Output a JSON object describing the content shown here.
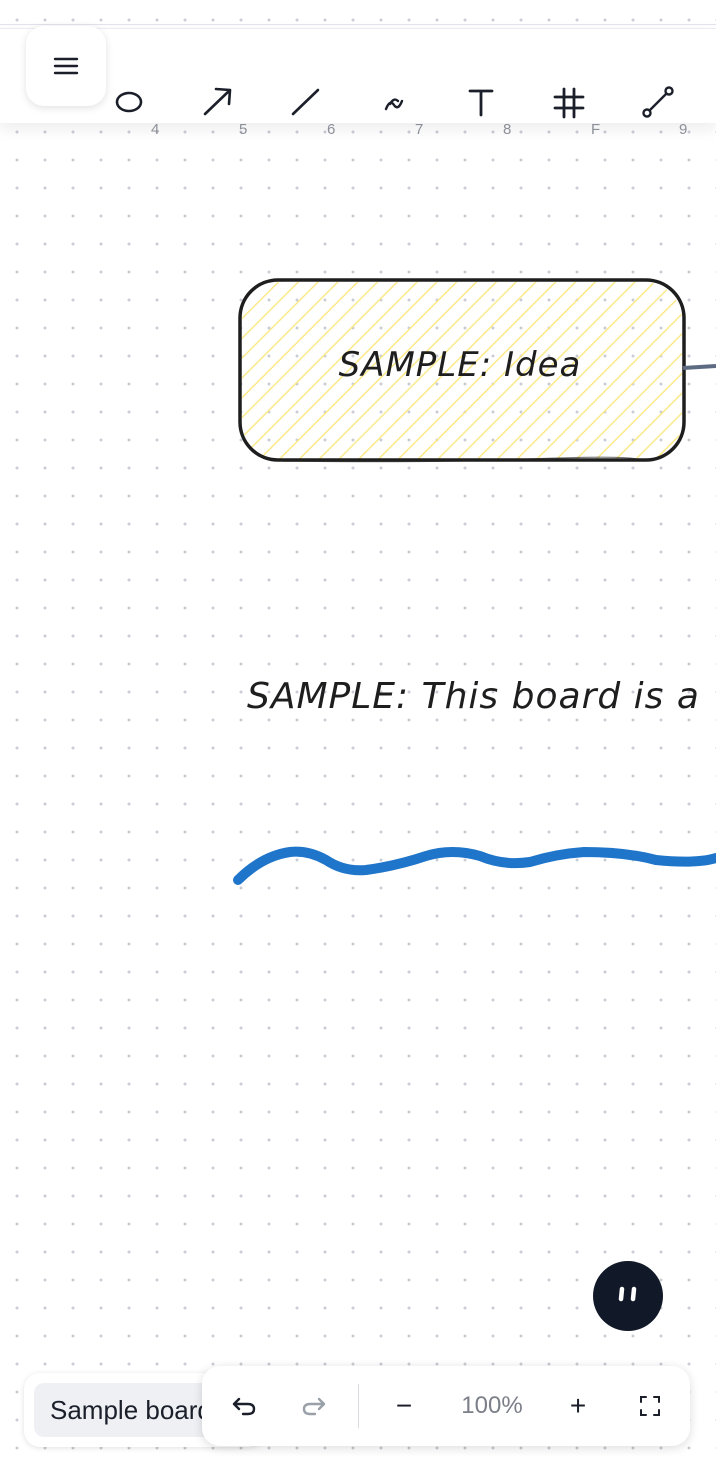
{
  "toolbar": {
    "menu_icon": "hamburger-menu-icon",
    "tools": [
      {
        "name": "ellipse",
        "icon": "ellipse-icon",
        "shortcut": "4"
      },
      {
        "name": "arrow",
        "icon": "arrow-icon",
        "shortcut": "5"
      },
      {
        "name": "line",
        "icon": "line-icon",
        "shortcut": "6"
      },
      {
        "name": "draw",
        "icon": "freehand-icon",
        "shortcut": "7"
      },
      {
        "name": "text",
        "icon": "text-icon",
        "shortcut": "8"
      },
      {
        "name": "frame",
        "icon": "frame-icon",
        "shortcut": "F"
      },
      {
        "name": "connector",
        "icon": "connector-icon",
        "shortcut": "9"
      }
    ]
  },
  "canvas": {
    "idea_shape": {
      "text": "SAMPLE: Idea",
      "fill": "#fbe98a",
      "stroke": "#1e1e1e"
    },
    "board_text": "SAMPLE: This board is a",
    "freehand_stroke_color": "#1f75c9",
    "connector_color": "#5c6a82"
  },
  "bottom": {
    "board_name": "Sample board",
    "undo_icon": "undo-icon",
    "redo_icon": "redo-icon",
    "zoom_out_label": "−",
    "zoom_level": "100%",
    "zoom_in_label": "+",
    "fit_icon": "fit-screen-icon"
  },
  "colors": {
    "accent_dark": "#111827",
    "background": "#ffffff"
  }
}
